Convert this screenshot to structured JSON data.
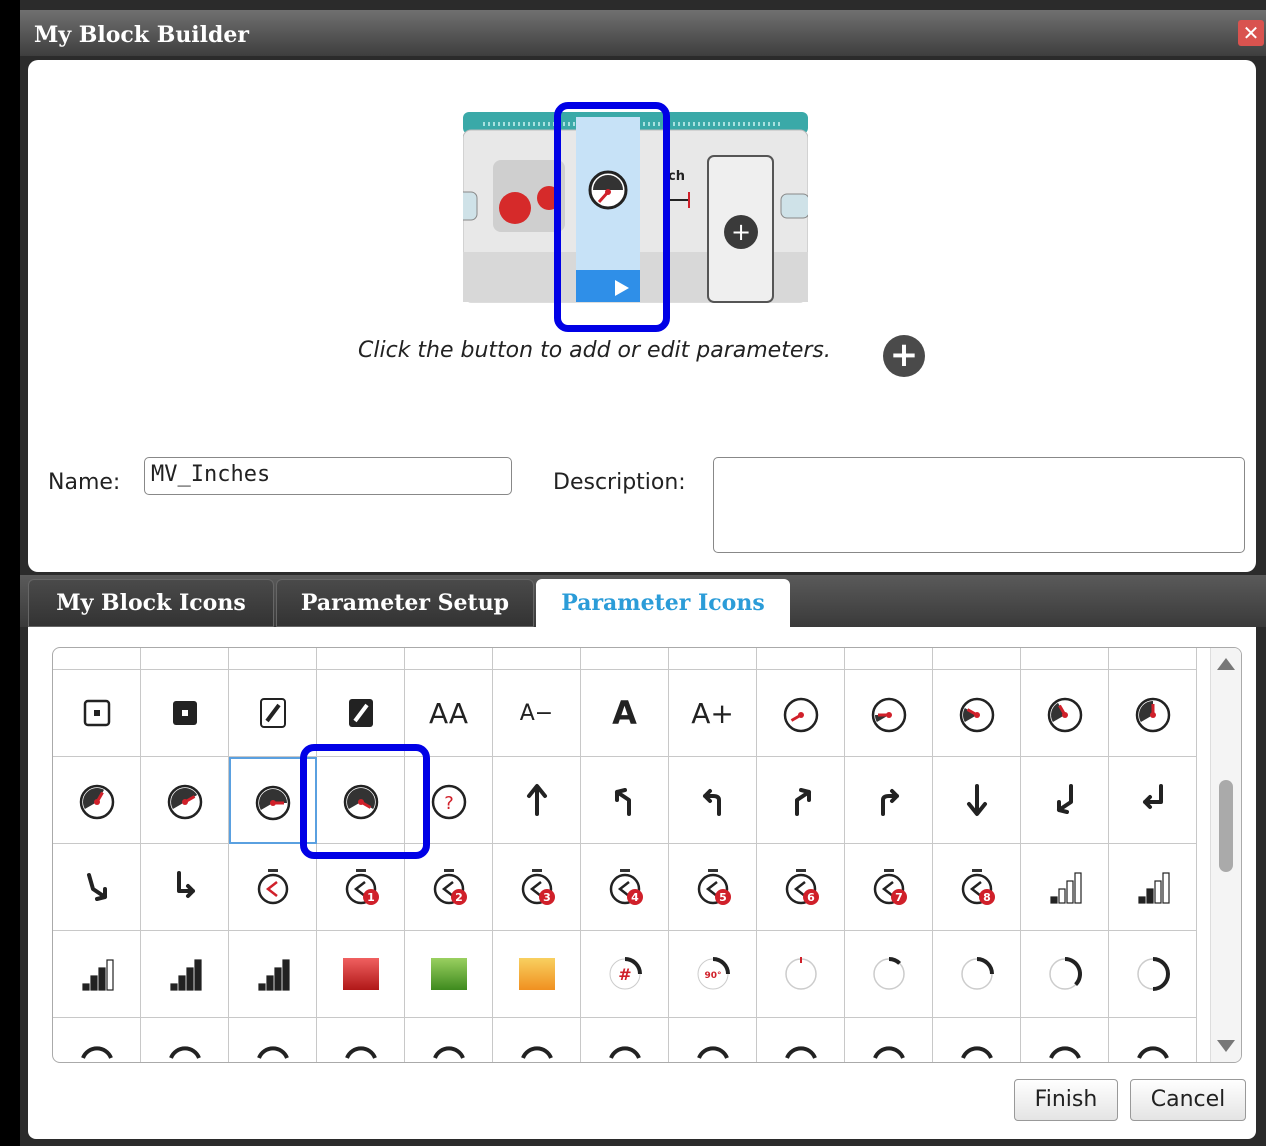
{
  "window": {
    "title": "My Block Builder",
    "close_icon": "close-icon"
  },
  "top": {
    "hint": "Click the button to add or edit parameters.",
    "add_param_icon": "plus-circle-icon",
    "block_partial_label": "ch",
    "name_label": "Name:",
    "name_value": "MV_Inches",
    "description_label": "Description:",
    "description_value": ""
  },
  "tabs": [
    {
      "label": "My Block Icons",
      "active": false
    },
    {
      "label": "Parameter Setup",
      "active": false
    },
    {
      "label": "Parameter Icons",
      "active": true
    }
  ],
  "icon_grid": {
    "rows": [
      [
        "square-dot-outline-icon",
        "square-dot-filled-icon",
        "pencil-outline-icon",
        "pencil-filled-icon",
        "AA",
        "A−",
        "A",
        "A+",
        "gauge-0-icon",
        "gauge-1-icon",
        "gauge-2-icon",
        "gauge-3-icon",
        "gauge-4-icon"
      ],
      [
        "gauge-5-icon",
        "gauge-6-icon",
        "gauge-7-icon",
        "gauge-8-icon",
        "gauge-question-icon",
        "arrow-up-icon",
        "turn-left-sharp-icon",
        "turn-left-icon",
        "turn-right-sharp-icon",
        "turn-right-icon",
        "arrow-down-icon",
        "curve-down-left-icon",
        "return-left-icon"
      ],
      [
        "curve-down-right-icon",
        "corner-down-right-icon",
        "timer-icon",
        "timer-1-icon",
        "timer-2-icon",
        "timer-3-icon",
        "timer-4-icon",
        "timer-5-icon",
        "timer-6-icon",
        "timer-7-icon",
        "timer-8-icon",
        "signal-bars-1-icon",
        "signal-bars-2-icon"
      ],
      [
        "signal-bars-3-icon",
        "signal-bars-4-icon",
        "signal-bars-5-icon",
        "red-square-icon",
        "green-square-icon",
        "orange-square-icon",
        "rotation-number-icon",
        "rotation-degrees-icon",
        "arc-0-icon",
        "arc-1-icon",
        "arc-2-icon",
        "arc-3-icon",
        "arc-4-icon"
      ]
    ],
    "badges": {
      "timer-1-icon": "1",
      "timer-2-icon": "2",
      "timer-3-icon": "3",
      "timer-4-icon": "4",
      "timer-5-icon": "5",
      "timer-6-icon": "6",
      "timer-7-icon": "7",
      "timer-8-icon": "8",
      "rotation-number-icon": "#",
      "rotation-degrees-icon": "90°",
      "gauge-question-icon": "?"
    },
    "selected": "gauge-7-icon",
    "highlighted": "gauge-8-icon"
  },
  "buttons": {
    "finish": "Finish",
    "cancel": "Cancel"
  },
  "colors": {
    "accent": "#2b9cd8",
    "highlight": "#0000e6",
    "gauge_needle": "#d0202a",
    "block_teal": "#3aa9a8",
    "param_blue": "#2f8fe8"
  }
}
